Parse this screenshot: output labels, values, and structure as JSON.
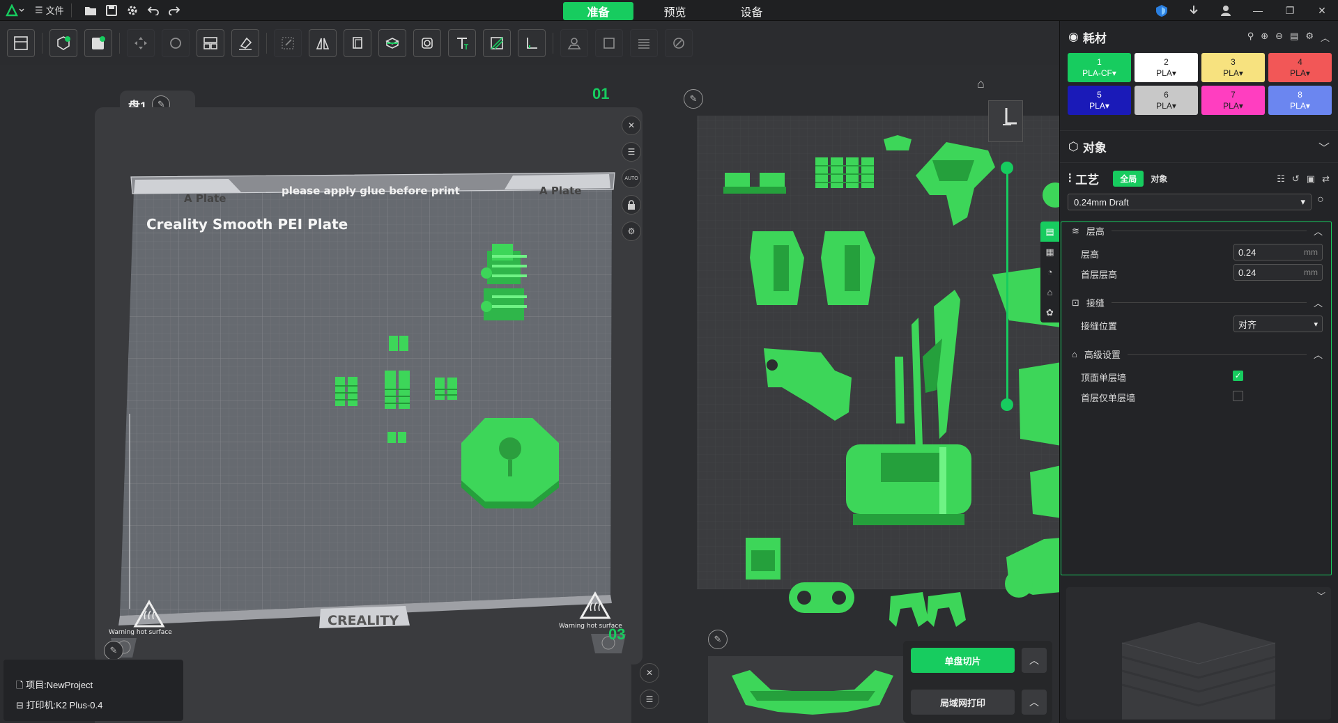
{
  "titlebar": {
    "file_menu": "文件",
    "tabs": [
      "准备",
      "预览",
      "设备"
    ],
    "active_tab": 0
  },
  "plates": {
    "plate1_label": "盘1",
    "plate1_number": "01",
    "plate3_number": "03",
    "bed_tab_left": "A Plate",
    "bed_tab_right": "A Plate",
    "bed_note": "please apply glue before print",
    "bed_name": "Creality Smooth PEI Plate",
    "bed_brand": "CREALITY",
    "warning_left": "Warning hot surface",
    "warning_right": "Warning hot surface",
    "auto_label": "AUTO"
  },
  "info": {
    "project": "项目:NewProject",
    "printer": "打印机:K2 Plus-0.4"
  },
  "actions": {
    "slice_single": "单盘切片",
    "lan_print": "局域网打印"
  },
  "panel": {
    "filament_title": "耗材",
    "filaments": [
      {
        "num": "1",
        "type": "PLA-CF",
        "color": "#17cc5f",
        "text": "#ffffff"
      },
      {
        "num": "2",
        "type": "PLA",
        "color": "#ffffff",
        "text": "#222222"
      },
      {
        "num": "3",
        "type": "PLA",
        "color": "#f7e27f",
        "text": "#222222"
      },
      {
        "num": "4",
        "type": "PLA",
        "color": "#f25757",
        "text": "#222222"
      },
      {
        "num": "5",
        "type": "PLA",
        "color": "#1a1ab8",
        "text": "#ffffff"
      },
      {
        "num": "6",
        "type": "PLA",
        "color": "#c8c8c8",
        "text": "#222222"
      },
      {
        "num": "7",
        "type": "PLA",
        "color": "#ff3ec0",
        "text": "#222222"
      },
      {
        "num": "8",
        "type": "PLA",
        "color": "#6b86f0",
        "text": "#ffffff"
      }
    ],
    "object_title": "对象",
    "craft_title": "工艺",
    "craft_toggle_global": "全局",
    "craft_toggle_object": "对象",
    "preset": "0.24mm Draft",
    "groups": {
      "layer": "层高",
      "seam": "接缝",
      "advanced": "高级设置"
    },
    "rows": {
      "layer_height_label": "层高",
      "layer_height_value": "0.24",
      "first_layer_label": "首层层高",
      "first_layer_value": "0.24",
      "unit": "mm",
      "seam_pos_label": "接缝位置",
      "seam_pos_value": "对齐",
      "top_wall_label": "顶面单层墙",
      "first_wall_label": "首层仅单层墙"
    },
    "accent": "#17cc5f"
  }
}
